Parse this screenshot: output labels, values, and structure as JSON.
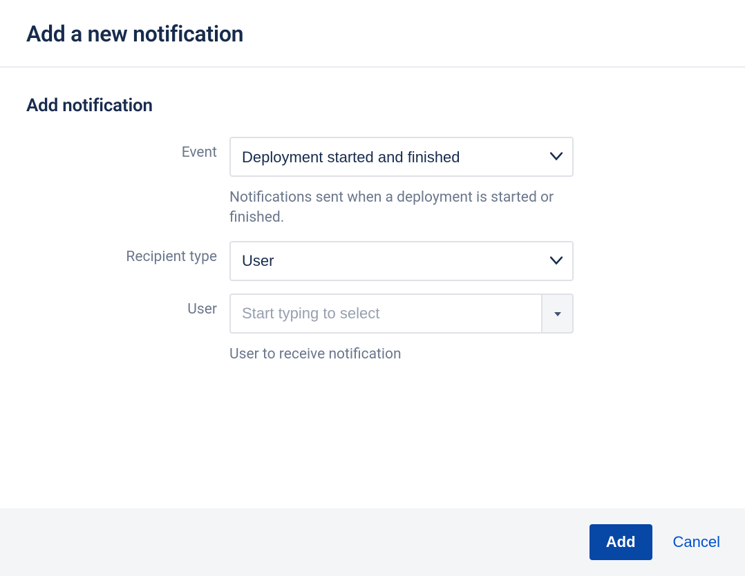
{
  "header": {
    "title": "Add a new notification"
  },
  "form": {
    "title": "Add notification",
    "event": {
      "label": "Event",
      "value": "Deployment started and finished",
      "helper": "Notifications sent when a deployment is started or finished."
    },
    "recipientType": {
      "label": "Recipient type",
      "value": "User"
    },
    "user": {
      "label": "User",
      "placeholder": "Start typing to select",
      "helper": "User to receive notification"
    }
  },
  "footer": {
    "add": "Add",
    "cancel": "Cancel"
  }
}
